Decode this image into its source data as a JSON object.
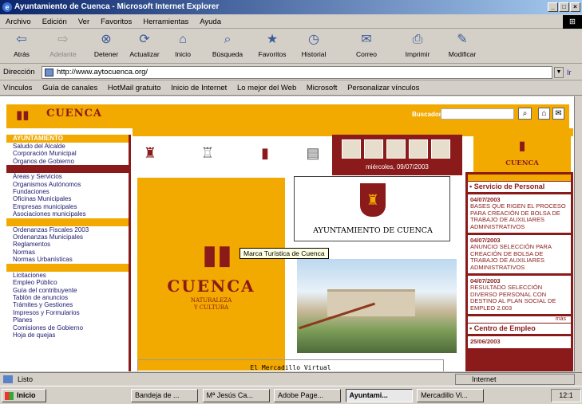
{
  "window": {
    "title": "Ayuntamiento de Cuenca - Microsoft Internet Explorer",
    "min": "_",
    "max": "□",
    "close": "×"
  },
  "menu": [
    "Archivo",
    "Edición",
    "Ver",
    "Favoritos",
    "Herramientas",
    "Ayuda"
  ],
  "toolbar": [
    {
      "label": "Atrás",
      "icon": "back-icon"
    },
    {
      "label": "Adelante",
      "icon": "forward-icon"
    },
    {
      "label": "Detener",
      "icon": "stop-icon"
    },
    {
      "label": "Actualizar",
      "icon": "refresh-icon"
    },
    {
      "label": "Inicio",
      "icon": "home-icon"
    },
    {
      "label": "Búsqueda",
      "icon": "search-icon"
    },
    {
      "label": "Favoritos",
      "icon": "favorites-icon"
    },
    {
      "label": "Historial",
      "icon": "history-icon"
    },
    {
      "label": "Correo",
      "icon": "mail-icon"
    },
    {
      "label": "Imprimir",
      "icon": "print-icon"
    },
    {
      "label": "Modificar",
      "icon": "edit-icon"
    }
  ],
  "address": {
    "label": "Dirección",
    "value": "http://www.aytocuenca.org/",
    "go": "Ir"
  },
  "links": {
    "label": "Vínculos",
    "items": [
      "Guía de canales",
      "HotMail gratuito",
      "Inicio de Internet",
      "Lo mejor del Web",
      "Microsoft",
      "Personalizar vínculos"
    ]
  },
  "site": {
    "name": "CUENCA",
    "search_label": "Buscador",
    "left_sections": [
      {
        "head": "AYUNTAMIENTO",
        "items": [
          "Saludo del Alcalde",
          "Corporación Municipal",
          "Órganos de Gobierno"
        ]
      },
      {
        "head": "",
        "items": [
          "Áreas y Servicios",
          "Organismos Autónomos",
          "Fundaciones",
          "Oficinas Municipales",
          "Empresas municipales",
          "Asociaciones municipales"
        ]
      },
      {
        "head": "",
        "items": [
          "Ordenanzas Fiscales 2003",
          "Ordenanzas Municipales",
          "Reglamentos",
          "Normas",
          "Normas Urbanísticas"
        ]
      },
      {
        "head": "",
        "items": [
          "Licitaciones",
          "Empleo Público",
          "Guía del contribuyente",
          "Tablón de anuncios",
          "Trámites y Gestiones",
          "Impresos y Formularios",
          "Planes",
          "Comisiones de Gobierno",
          "Hoja de quejas"
        ]
      }
    ],
    "date": "miércoles, 09/07/2003",
    "badge": "CUENCA",
    "brand": {
      "title": "CUENCA",
      "tag1": "NATURALEZA",
      "tag2": "Y CULTURA"
    },
    "tooltip": "Marca Turística de Cuenca",
    "ayto": "AYUNTAMIENTO DE CUENCA",
    "mercadillo": "El Mercadillo Virtual",
    "sidebar": {
      "section": "Servicio de Personal",
      "news": [
        {
          "date": "04/07/2003",
          "text": "BASES QUE RIGEN EL PROCESO PARA CREACIÓN DE BOLSA DE TRABAJO DE AUXILIARES ADMINISTRATIVOS"
        },
        {
          "date": "04/07/2003",
          "text": "ANUNCIO SELECCIÓN PARA CREACIÓN DE BOLSA DE TRABAJO DE AUXILIARES ADMINISTRATIVOS"
        },
        {
          "date": "04/07/2003",
          "text": "RESULTADO SELECCIÓN DIVERSO PERSONAL CON DESTINO AL PLAN SOCIAL DE EMPLEO 2.003"
        }
      ],
      "more": "más",
      "section2": "Centro de Empleo",
      "news2_date": "25/06/2003"
    }
  },
  "status": {
    "text": "Listo",
    "zone": "Internet"
  },
  "taskbar": {
    "start": "Inicio",
    "tasks": [
      "Bandeja de ...",
      "Mª Jesús Ca...",
      "Adobe Page...",
      "Ayuntami...",
      "Mercadillo Vi..."
    ],
    "clock": "12:1"
  }
}
